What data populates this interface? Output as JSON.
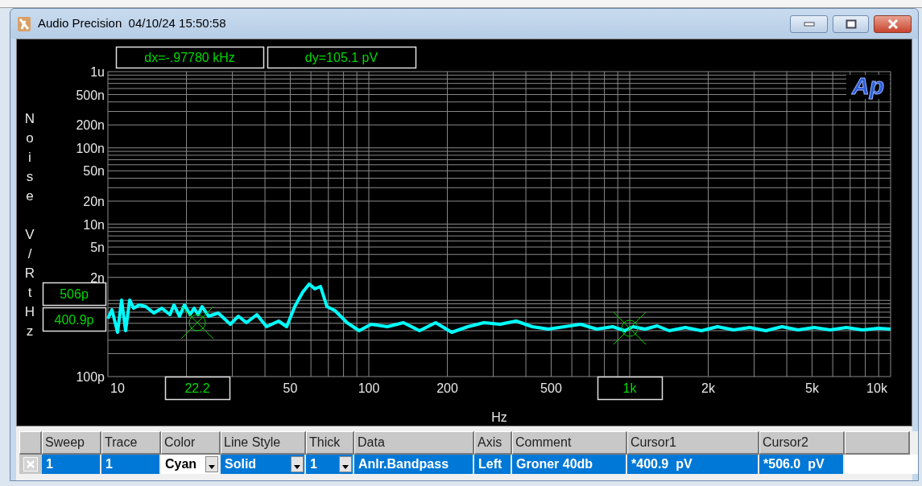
{
  "window": {
    "title": "Audio Precision  04/10/24 15:50:58"
  },
  "graph": {
    "logo": "Ap",
    "readouts": [
      "dx=-.97780 kHz",
      "dy=105.1  pV"
    ],
    "y_axis_label": "Noise V/RtHz",
    "y_tick_labels": [
      "1u",
      "500n",
      "200n",
      "100n",
      "50n",
      "20n",
      "10n",
      "5n",
      "2n",
      "100p"
    ],
    "y_cursor_labels": [
      "506p",
      "400.9p"
    ],
    "x_tick_labels": [
      "10",
      "50",
      "100",
      "200",
      "500",
      "2k",
      "5k",
      "10k"
    ],
    "x_cursor_labels": [
      "22.2",
      "1k"
    ],
    "x_axis_label": "Hz"
  },
  "table": {
    "columns": [
      "Sweep",
      "Trace",
      "Color",
      "Line Style",
      "Thick",
      "Data",
      "Axis",
      "Comment",
      "Cursor1",
      "Cursor2"
    ],
    "rows": [
      {
        "selected": true,
        "checked": true,
        "cells": [
          {
            "text": "1",
            "kind": "text"
          },
          {
            "text": "1",
            "kind": "text"
          },
          {
            "text": "Cyan",
            "kind": "dropdown",
            "focused": true
          },
          {
            "text": "Solid",
            "kind": "dropdown",
            "focused": false
          },
          {
            "text": "1",
            "kind": "dropdown",
            "focused": false
          },
          {
            "text": "Anlr.Bandpass",
            "kind": "text"
          },
          {
            "text": "Left",
            "kind": "text"
          },
          {
            "text": "Groner 40db",
            "kind": "text"
          },
          {
            "text": "*400.9  pV",
            "kind": "text"
          },
          {
            "text": "*506.0  pV",
            "kind": "text"
          }
        ]
      }
    ]
  }
}
